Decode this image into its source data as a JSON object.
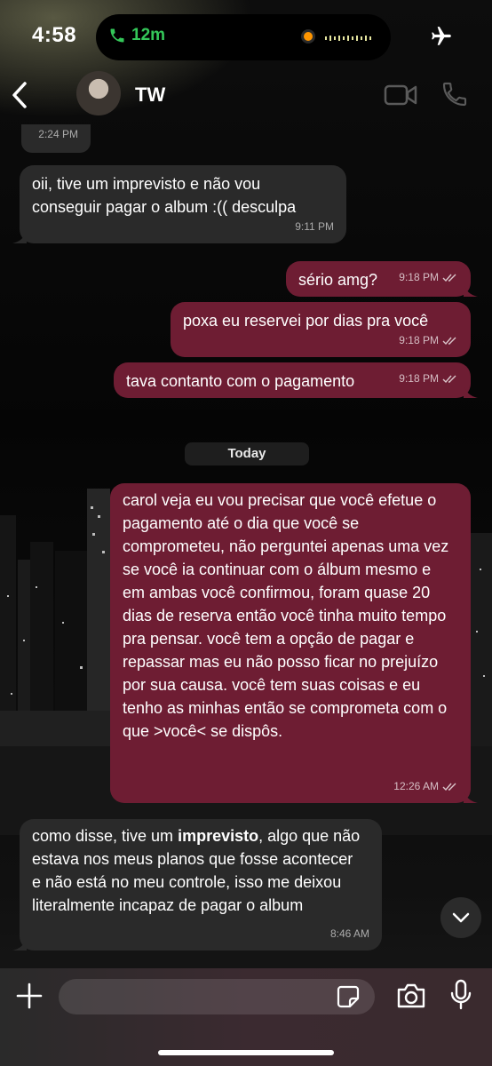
{
  "status_bar": {
    "time": "4:58",
    "call_duration": "12m",
    "icons": [
      "phone-icon",
      "waveform-icon",
      "privacy-dot",
      "airplane-mode-icon"
    ]
  },
  "header": {
    "contact_name": "TW",
    "icons": [
      "back-chevron-icon",
      "avatar",
      "video-call-icon",
      "voice-call-icon"
    ]
  },
  "messages": [
    {
      "direction": "in",
      "text": "",
      "time": "2:24 PM"
    },
    {
      "direction": "in",
      "text": "oii, tive um imprevisto e não vou conseguir pagar o album :(( desculpa",
      "time": "9:11 PM"
    },
    {
      "direction": "out",
      "text": "sério amg?",
      "time": "9:18 PM",
      "status": "read"
    },
    {
      "direction": "out",
      "text": "poxa eu reservei por dias pra você",
      "time": "9:18 PM",
      "status": "read"
    },
    {
      "direction": "out",
      "text": "tava contanto com o pagamento",
      "time": "9:18 PM",
      "status": "read"
    },
    {
      "direction": "out",
      "text": "carol veja eu vou precisar que você efetue o pagamento até o dia que você se comprometeu, não perguntei apenas uma vez se você ia continuar com o álbum mesmo e em ambas você confirmou, foram quase 20 dias de reserva então você tinha muito tempo pra pensar. você tem a opção de pagar e repassar mas eu não posso ficar no prejuízo por sua causa. você tem suas coisas e eu tenho as minhas então se comprometa com o que >você< se dispôs.",
      "time": "12:26 AM",
      "status": "read"
    },
    {
      "direction": "in",
      "text_before": "como disse, tive um ",
      "text_bold": "imprevisto",
      "text_after": ", algo que não estava nos meus planos que fosse acontecer e não está no meu controle, isso me deixou literalmente incapaz de pagar o album",
      "time": "8:46 AM"
    }
  ],
  "date_separator": "Today",
  "input": {
    "placeholder": "",
    "value": ""
  },
  "colors": {
    "incoming_bubble": "#2a2a2a",
    "outgoing_bubble": "#6e1d33",
    "call_green": "#34c759",
    "privacy_orange": "#ff9500"
  }
}
